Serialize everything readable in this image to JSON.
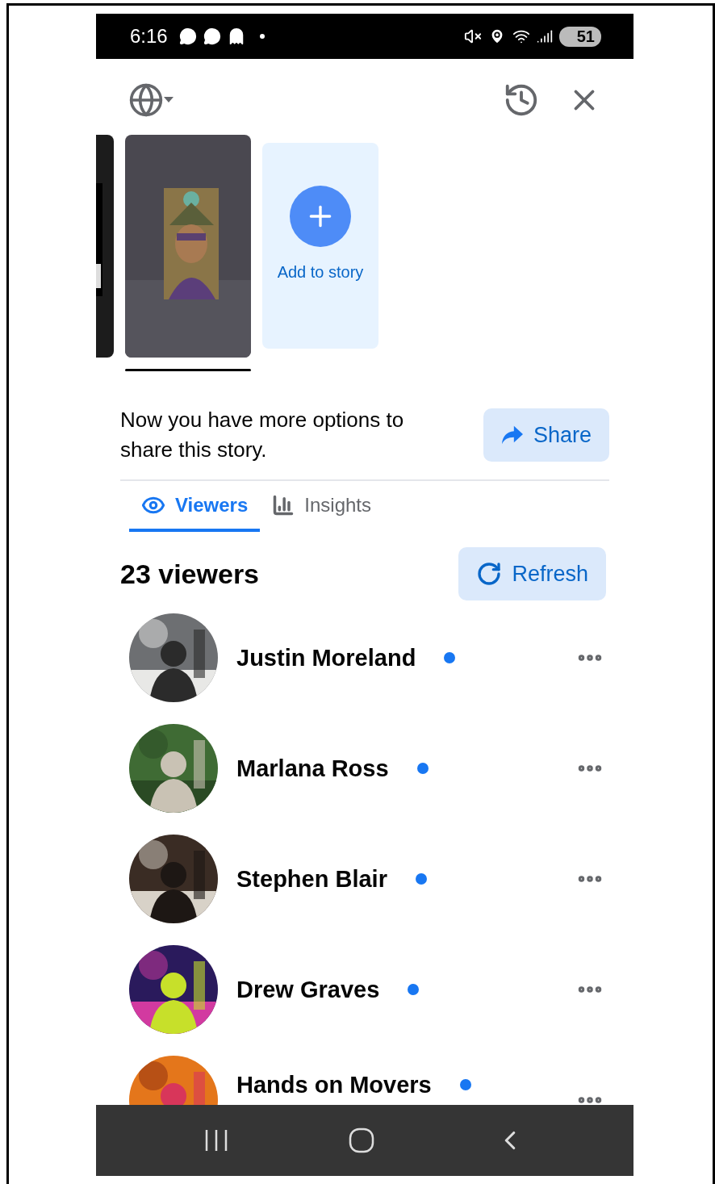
{
  "status_bar": {
    "time": "6:16",
    "battery": "51"
  },
  "stories": [
    {
      "kind": "picture",
      "selected": false
    },
    {
      "kind": "picture",
      "selected": true
    },
    {
      "kind": "add",
      "label": "Add to story"
    }
  ],
  "share_prompt": {
    "text": "Now you have more options to share this story.",
    "button": "Share"
  },
  "tabs": [
    {
      "label": "Viewers",
      "selected": true
    },
    {
      "label": "Insights",
      "selected": false
    }
  ],
  "viewers": {
    "count": "23 viewers",
    "refresh": "Refresh",
    "items": [
      {
        "name": "Justin Moreland",
        "new": true
      },
      {
        "name": "Marlana Ross",
        "new": true
      },
      {
        "name": "Stephen Blair",
        "new": true
      },
      {
        "name": "Drew Graves",
        "new": true
      },
      {
        "name": "Hands on Movers",
        "new": true
      }
    ]
  }
}
